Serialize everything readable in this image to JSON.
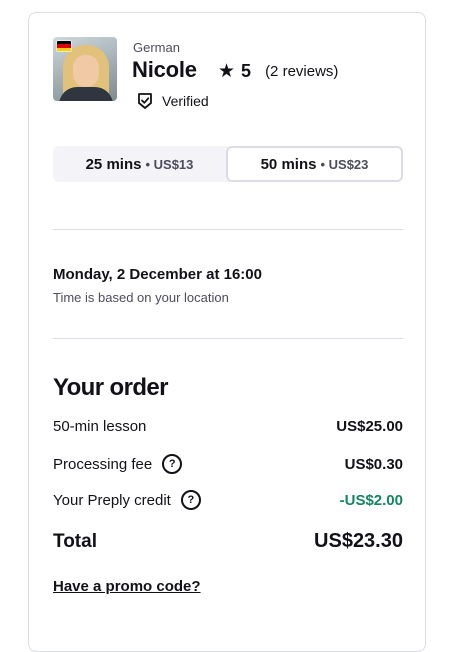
{
  "tutor": {
    "language": "German",
    "name": "Nicole",
    "rating": "5",
    "reviews": "(2 reviews)",
    "verified": "Verified"
  },
  "durations": [
    {
      "duration": "25 mins",
      "price": "• US$13",
      "selected": false
    },
    {
      "duration": "50 mins",
      "price": "• US$23",
      "selected": true
    }
  ],
  "schedule": {
    "datetime": "Monday, 2 December at 16:00",
    "note": "Time is based on your location"
  },
  "order": {
    "title": "Your order",
    "lines": [
      {
        "label": "50-min lesson",
        "value": "US$25.00"
      },
      {
        "label": "Processing fee",
        "value": "US$0.30"
      },
      {
        "label": "Your Preply credit",
        "value": "-US$2.00"
      }
    ],
    "total_label": "Total",
    "total_value": "US$23.30",
    "promo": "Have a promo code?"
  },
  "colors": {
    "credit": "#13855f",
    "border": "#dcdce5",
    "text": "#121117"
  }
}
